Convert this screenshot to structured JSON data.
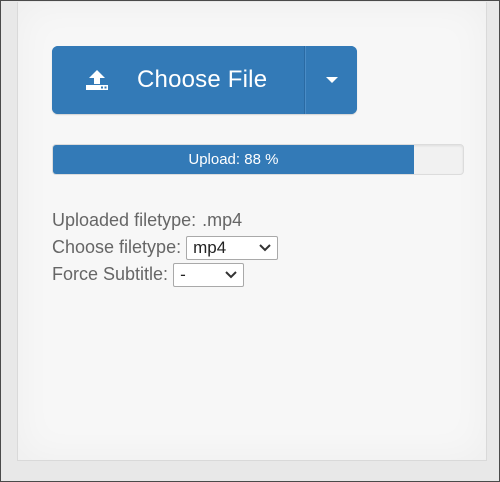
{
  "upload_button": {
    "label": "Choose File",
    "icon": "upload-icon",
    "dropdown_icon": "caret-down-icon"
  },
  "progress": {
    "label": "Upload: 88 %",
    "percent": 88
  },
  "info": {
    "uploaded_filetype_label": "Uploaded filetype:",
    "uploaded_filetype_value": ".mp4",
    "choose_filetype_label": "Choose filetype:",
    "choose_filetype_value": "mp4",
    "force_subtitle_label": "Force Subtitle:",
    "force_subtitle_value": "-"
  },
  "colors": {
    "primary": "#337ab7",
    "text": "#666666"
  }
}
